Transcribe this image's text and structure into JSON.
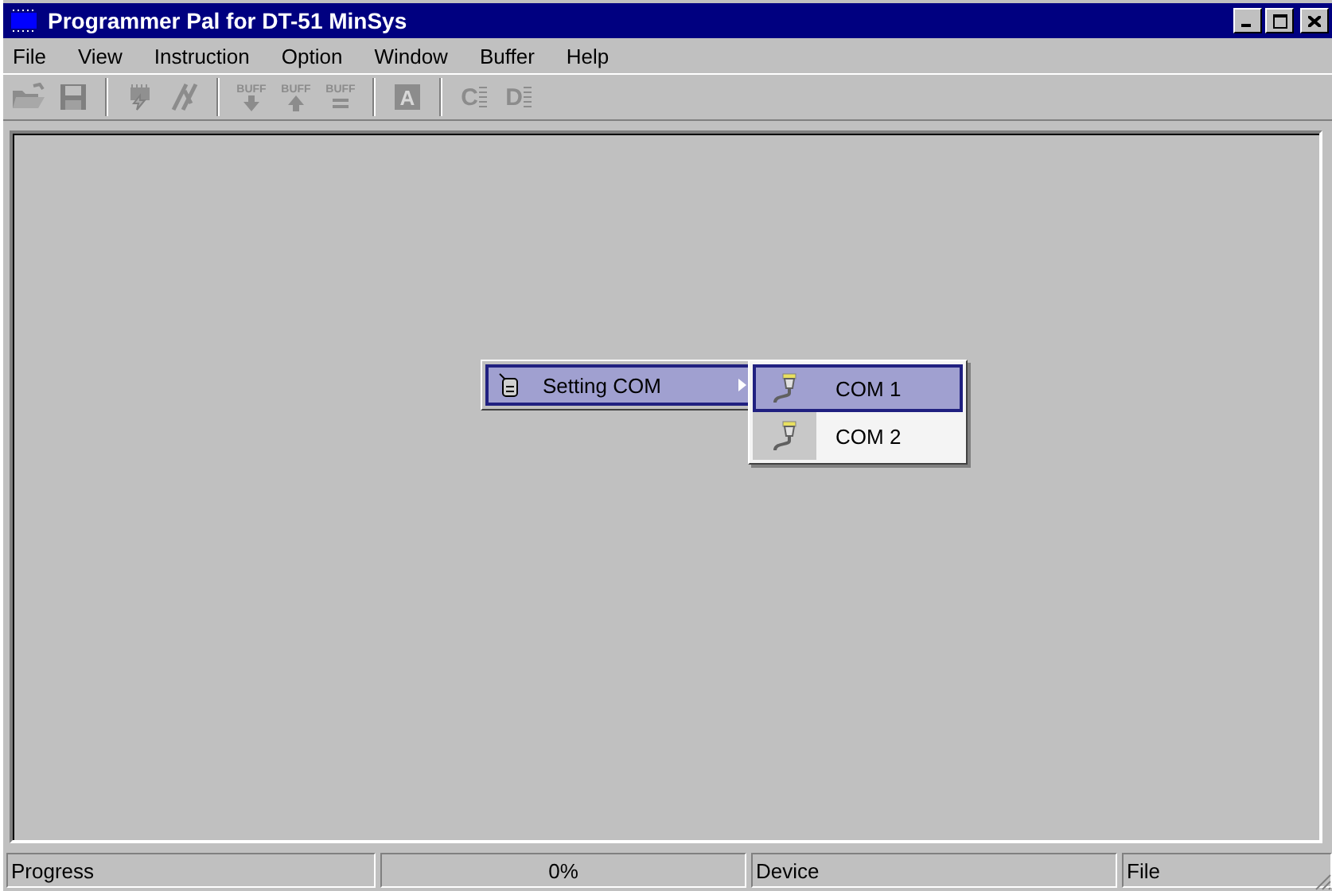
{
  "window": {
    "title": "Programmer Pal for DT-51 MinSys"
  },
  "menu_bar": [
    "File",
    "View",
    "Instruction",
    "Option",
    "Window",
    "Buffer",
    "Help"
  ],
  "toolbar": [
    [
      {
        "kind": "open",
        "disabled": true
      },
      {
        "kind": "save",
        "disabled": true
      }
    ],
    [
      {
        "kind": "chip",
        "disabled": true
      },
      {
        "kind": "flash",
        "disabled": true
      }
    ],
    [
      {
        "kind": "buff-down",
        "text": "BUFF",
        "disabled": true
      },
      {
        "kind": "buff-up",
        "text": "BUFF",
        "disabled": true
      },
      {
        "kind": "buff-equal",
        "text": "BUFF",
        "disabled": true
      }
    ],
    [
      {
        "kind": "letter",
        "text": "A",
        "disabled": true
      }
    ],
    [
      {
        "kind": "letter-buff",
        "text": "C",
        "disabled": true
      },
      {
        "kind": "letter-buff",
        "text": "D",
        "disabled": true
      }
    ]
  ],
  "context_menu": {
    "items": [
      {
        "label": "Setting COM",
        "selected": true,
        "has_submenu": true
      }
    ]
  },
  "submenu": {
    "items": [
      {
        "label": "COM 1",
        "selected": true
      },
      {
        "label": "COM 2",
        "selected": false
      }
    ]
  },
  "status_bar": [
    "Progress",
    "0%",
    "Device",
    "File"
  ]
}
